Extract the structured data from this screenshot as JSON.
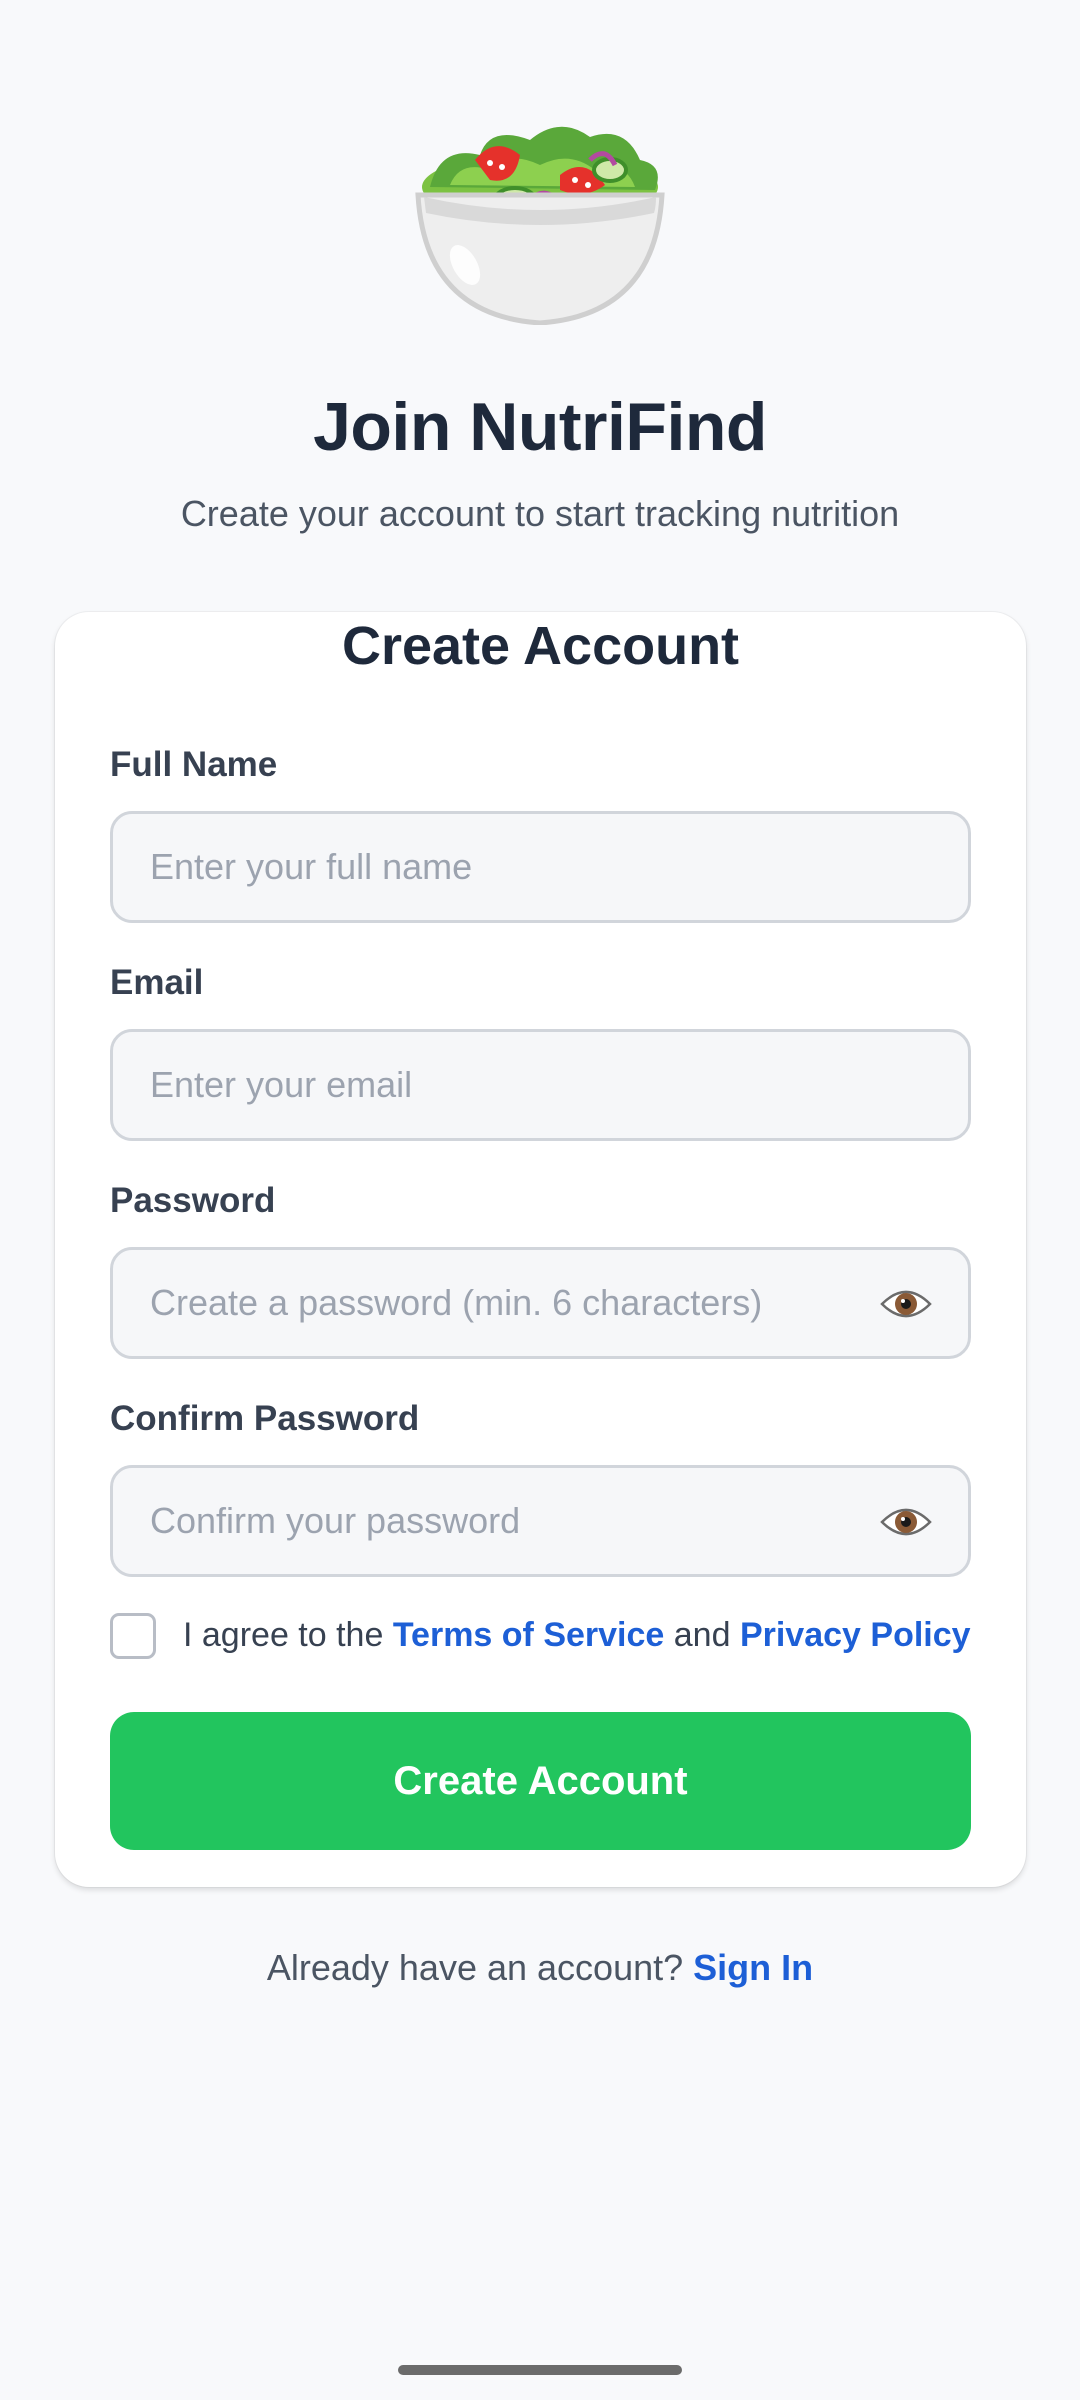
{
  "header": {
    "logo_icon": "salad-bowl-icon",
    "title": "Join NutriFind",
    "subtitle": "Create your account to start tracking nutrition"
  },
  "card": {
    "title": "Create Account",
    "fields": {
      "full_name": {
        "label": "Full Name",
        "placeholder": "Enter your full name",
        "value": ""
      },
      "email": {
        "label": "Email",
        "placeholder": "Enter your email",
        "value": ""
      },
      "password": {
        "label": "Password",
        "placeholder": "Create a password (min. 6 characters)",
        "value": "",
        "toggle_icon": "eye-icon"
      },
      "confirm_password": {
        "label": "Confirm Password",
        "placeholder": "Confirm your password",
        "value": "",
        "toggle_icon": "eye-icon"
      }
    },
    "terms": {
      "checked": false,
      "prefix": "I agree to the ",
      "terms_link": "Terms of Service",
      "middle": " and ",
      "privacy_link": "Privacy Policy"
    },
    "submit_label": "Create Account"
  },
  "footer": {
    "prompt": "Already have an account? ",
    "signin_link": "Sign In"
  },
  "colors": {
    "background": "#f8f9fb",
    "primary": "#22c55e",
    "link": "#1d5fd6",
    "heading": "#1e293b"
  }
}
